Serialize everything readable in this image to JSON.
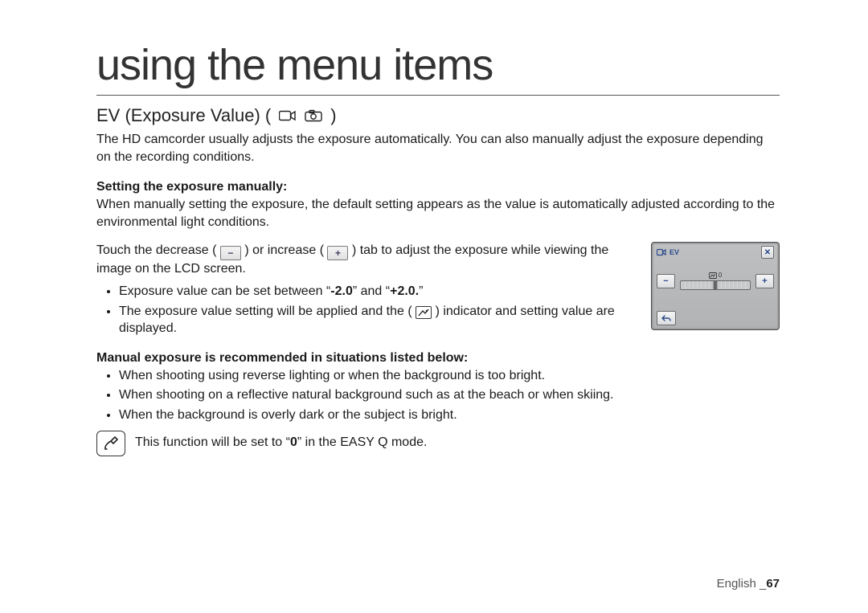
{
  "title": "using the menu items",
  "section": {
    "heading": "EV (Exposure Value) (",
    "heading_close": ")",
    "intro": "The HD camcorder usually adjusts the exposure automatically. You can also manually adjust the exposure depending on the recording conditions."
  },
  "manual": {
    "subhead": "Setting the exposure manually:",
    "para": "When manually setting the exposure, the default setting appears as the value is automatically adjusted according to the environmental light conditions.",
    "touch_pre": "Touch the decrease (",
    "touch_mid1": ") or increase (",
    "touch_mid2": ") tab to adjust the exposure while viewing the image on the LCD screen.",
    "bullets": {
      "b1_pre": "Exposure value can be set between “",
      "b1_min": "-2.0",
      "b1_mid": "” and “",
      "b1_max": "+2.0.",
      "b1_post": "”",
      "b2_pre": "The exposure value setting will be applied and the (",
      "b2_post": ") indicator and setting value are displayed."
    }
  },
  "recommended": {
    "subhead": "Manual exposure is recommended in situations listed below:",
    "items": [
      "When shooting using reverse lighting or when the background is too bright.",
      "When shooting on a reflective natural background such as at the beach or when skiing.",
      "When the background is overly dark or the subject is bright."
    ]
  },
  "note": {
    "pre": "This function will be set to “",
    "val": "0",
    "post": "” in the EASY Q mode."
  },
  "lcd": {
    "label": "EV",
    "ev_value": "0"
  },
  "footer": {
    "lang": "English _",
    "page": "67"
  }
}
